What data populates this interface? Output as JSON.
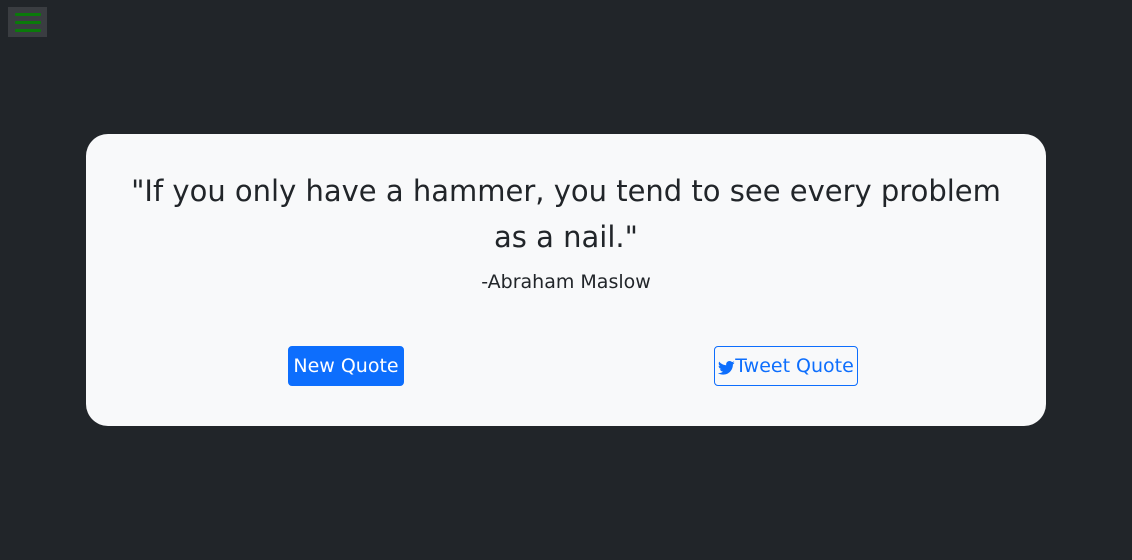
{
  "menu": {
    "icon": "hamburger-menu-icon",
    "bar_color": "#0a7a0a"
  },
  "quote": {
    "text": "\"If you only have a hammer, you tend to see every problem as a nail.\"",
    "author": "-Abraham Maslow"
  },
  "actions": {
    "new_quote_label": "New Quote",
    "tweet_quote_label": "Tweet Quote",
    "tweet_icon": "twitter-icon"
  },
  "colors": {
    "background": "#212529",
    "card": "#f8f9fa",
    "primary": "#0d6efd",
    "text": "#212529"
  }
}
